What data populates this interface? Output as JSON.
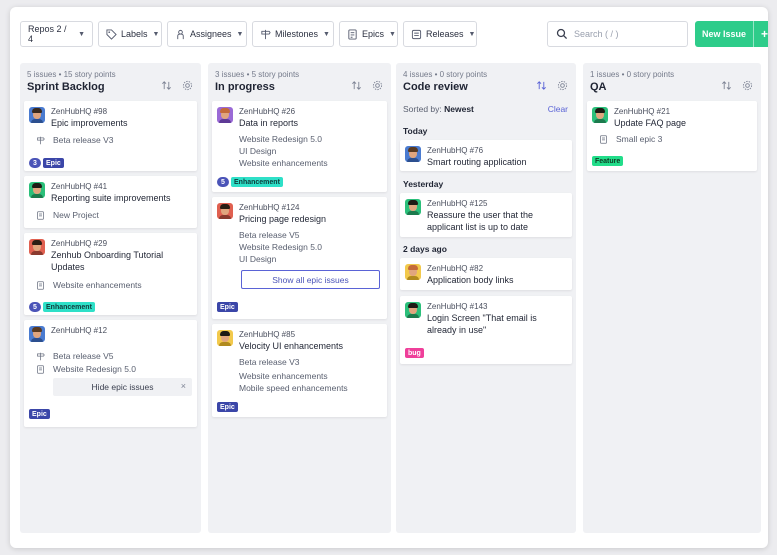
{
  "toolbar": {
    "repos": "Repos 2 / 4",
    "labels": "Labels",
    "assignees": "Assignees",
    "milestones": "Milestones",
    "epics": "Epics",
    "releases": "Releases",
    "search_placeholder": "Search ( / )",
    "new_issue": "New Issue",
    "new_issue_plus": "+"
  },
  "columns": [
    {
      "meta": "5 issues • 15 story points",
      "title": "Sprint Backlog",
      "cards": [
        {
          "ref": "ZenHubHQ #98",
          "title": "Epic improvements",
          "release": "Beta release V3",
          "tags": [
            "3",
            "Epic"
          ]
        },
        {
          "ref": "ZenHubHQ #41",
          "title": "Reporting suite improvements",
          "epic": "New Project"
        },
        {
          "ref": "ZenHubHQ #29",
          "title": "Zenhub Onboarding Tutorial",
          "title2": "Updates",
          "epic": "Website enhancements",
          "tags": [
            "5",
            "Enhancement"
          ]
        },
        {
          "ref": "ZenHubHQ #12",
          "release": "Beta release V5",
          "epic": "Website Redesign 5.0",
          "hide": "Hide epic issues",
          "close": "×",
          "tags": [
            "Epic"
          ]
        }
      ]
    },
    {
      "meta": "3 issues • 5 story points",
      "title": "In progress",
      "cards": [
        {
          "ref": "ZenHubHQ #26",
          "title": "Data in reports",
          "lines": [
            "Website Redesign 5.0",
            "UI Design",
            "Website enhancements"
          ],
          "tags": [
            "5",
            "Enhancement"
          ]
        },
        {
          "ref": "ZenHubHQ #124",
          "title": "Pricing page redesign",
          "lines": [
            "Beta release V5",
            "Website Redesign 5.0",
            "UI Design"
          ],
          "show": "Show all epic issues",
          "tags": [
            "Epic"
          ]
        },
        {
          "ref": "ZenHubHQ #85",
          "title": "Velocity UI enhancements",
          "lines": [
            "Beta release V3",
            "Website enhancements",
            "Mobile speed enhancements"
          ],
          "tags": [
            "Epic"
          ]
        }
      ]
    },
    {
      "meta": "4 issues • 0 story points",
      "title": "Code review",
      "sorted_prefix": "Sorted by:",
      "sorted_value": "Newest",
      "clear": "Clear",
      "groups": [
        "Today",
        "Yesterday",
        "2 days ago"
      ],
      "cards": [
        {
          "ref": "ZenHubHQ #76",
          "title": "Smart routing application"
        },
        {
          "ref": "ZenHubHQ #125",
          "title": "Reassure the user that the",
          "title2": "applicant list is up to date"
        },
        {
          "ref": "ZenHubHQ #82",
          "title": "Application body links"
        },
        {
          "ref": "ZenHubHQ #143",
          "title": "Login Screen \"That email is",
          "title2": "already in use\"",
          "tags": [
            "bug"
          ]
        }
      ]
    },
    {
      "meta": "1 issues • 0 story points",
      "title": "QA",
      "cards": [
        {
          "ref": "ZenHubHQ #21",
          "title": "Update FAQ page",
          "epic": "Small epic 3",
          "tags": [
            "Feature"
          ]
        }
      ]
    }
  ],
  "colors": {
    "accent": "#5a63d6",
    "new_issue": "#2ecc8a",
    "epic": "#3b46a8",
    "enhancement": "#2ee0c8",
    "bug": "#ef3f9a",
    "feature": "#22dd8a"
  }
}
